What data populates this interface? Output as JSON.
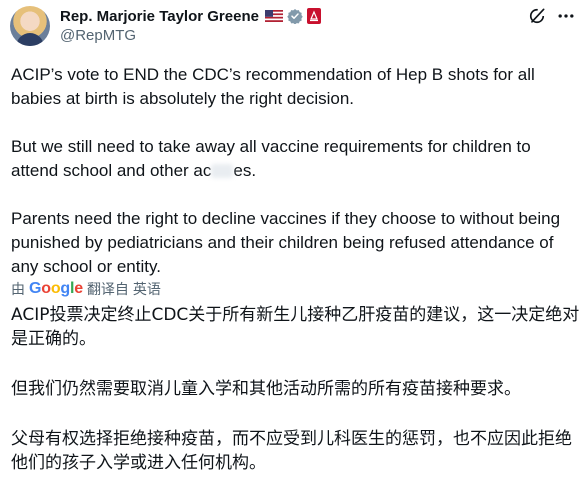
{
  "author": {
    "display_name": "Rep. Marjorie Taylor Greene",
    "handle": "@RepMTG",
    "badges": [
      "us-flag-icon",
      "verified-icon",
      "government-seal-icon"
    ],
    "colors": {
      "verified": "#829aab",
      "seal": "#c8102e"
    }
  },
  "header_actions": [
    "grok-icon",
    "more-icon"
  ],
  "tweet": {
    "paragraphs": [
      "ACIP’s vote to END the CDC’s recommendation of Hep B shots for all babies at birth is absolutely the right decision.",
      "Parents need the right to decline vaccines if they choose to without being punished by pediatricians and their children being refused attendance of any school or entity."
    ],
    "paragraph2_before": "But we still need to take away all vaccine requirements for children to attend school and other ac",
    "paragraph2_after": "es."
  },
  "translation": {
    "by_label": "由",
    "provider": "Google",
    "action_label": "翻译自 英语",
    "paragraphs": [
      "ACIP投票决定终止CDC关于所有新生儿接种乙肝疫苗的建议，这一决定绝对是正确的。",
      "但我们仍然需要取消儿童入学和其他活动所需的所有疫苗接种要求。",
      "父母有权选择拒绝接种疫苗，而不应受到儿科医生的惩罚，也不应因此拒绝他们的孩子入学或进入任何机构。"
    ]
  }
}
